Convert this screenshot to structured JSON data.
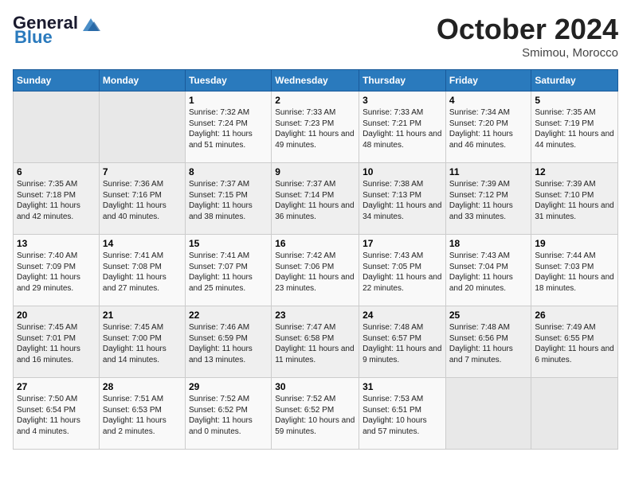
{
  "header": {
    "logo_general": "General",
    "logo_blue": "Blue",
    "month": "October 2024",
    "location": "Smimou, Morocco"
  },
  "days_of_week": [
    "Sunday",
    "Monday",
    "Tuesday",
    "Wednesday",
    "Thursday",
    "Friday",
    "Saturday"
  ],
  "weeks": [
    [
      {
        "day": "",
        "content": ""
      },
      {
        "day": "",
        "content": ""
      },
      {
        "day": "1",
        "content": "Sunrise: 7:32 AM\nSunset: 7:24 PM\nDaylight: 11 hours and 51 minutes."
      },
      {
        "day": "2",
        "content": "Sunrise: 7:33 AM\nSunset: 7:23 PM\nDaylight: 11 hours and 49 minutes."
      },
      {
        "day": "3",
        "content": "Sunrise: 7:33 AM\nSunset: 7:21 PM\nDaylight: 11 hours and 48 minutes."
      },
      {
        "day": "4",
        "content": "Sunrise: 7:34 AM\nSunset: 7:20 PM\nDaylight: 11 hours and 46 minutes."
      },
      {
        "day": "5",
        "content": "Sunrise: 7:35 AM\nSunset: 7:19 PM\nDaylight: 11 hours and 44 minutes."
      }
    ],
    [
      {
        "day": "6",
        "content": "Sunrise: 7:35 AM\nSunset: 7:18 PM\nDaylight: 11 hours and 42 minutes."
      },
      {
        "day": "7",
        "content": "Sunrise: 7:36 AM\nSunset: 7:16 PM\nDaylight: 11 hours and 40 minutes."
      },
      {
        "day": "8",
        "content": "Sunrise: 7:37 AM\nSunset: 7:15 PM\nDaylight: 11 hours and 38 minutes."
      },
      {
        "day": "9",
        "content": "Sunrise: 7:37 AM\nSunset: 7:14 PM\nDaylight: 11 hours and 36 minutes."
      },
      {
        "day": "10",
        "content": "Sunrise: 7:38 AM\nSunset: 7:13 PM\nDaylight: 11 hours and 34 minutes."
      },
      {
        "day": "11",
        "content": "Sunrise: 7:39 AM\nSunset: 7:12 PM\nDaylight: 11 hours and 33 minutes."
      },
      {
        "day": "12",
        "content": "Sunrise: 7:39 AM\nSunset: 7:10 PM\nDaylight: 11 hours and 31 minutes."
      }
    ],
    [
      {
        "day": "13",
        "content": "Sunrise: 7:40 AM\nSunset: 7:09 PM\nDaylight: 11 hours and 29 minutes."
      },
      {
        "day": "14",
        "content": "Sunrise: 7:41 AM\nSunset: 7:08 PM\nDaylight: 11 hours and 27 minutes."
      },
      {
        "day": "15",
        "content": "Sunrise: 7:41 AM\nSunset: 7:07 PM\nDaylight: 11 hours and 25 minutes."
      },
      {
        "day": "16",
        "content": "Sunrise: 7:42 AM\nSunset: 7:06 PM\nDaylight: 11 hours and 23 minutes."
      },
      {
        "day": "17",
        "content": "Sunrise: 7:43 AM\nSunset: 7:05 PM\nDaylight: 11 hours and 22 minutes."
      },
      {
        "day": "18",
        "content": "Sunrise: 7:43 AM\nSunset: 7:04 PM\nDaylight: 11 hours and 20 minutes."
      },
      {
        "day": "19",
        "content": "Sunrise: 7:44 AM\nSunset: 7:03 PM\nDaylight: 11 hours and 18 minutes."
      }
    ],
    [
      {
        "day": "20",
        "content": "Sunrise: 7:45 AM\nSunset: 7:01 PM\nDaylight: 11 hours and 16 minutes."
      },
      {
        "day": "21",
        "content": "Sunrise: 7:45 AM\nSunset: 7:00 PM\nDaylight: 11 hours and 14 minutes."
      },
      {
        "day": "22",
        "content": "Sunrise: 7:46 AM\nSunset: 6:59 PM\nDaylight: 11 hours and 13 minutes."
      },
      {
        "day": "23",
        "content": "Sunrise: 7:47 AM\nSunset: 6:58 PM\nDaylight: 11 hours and 11 minutes."
      },
      {
        "day": "24",
        "content": "Sunrise: 7:48 AM\nSunset: 6:57 PM\nDaylight: 11 hours and 9 minutes."
      },
      {
        "day": "25",
        "content": "Sunrise: 7:48 AM\nSunset: 6:56 PM\nDaylight: 11 hours and 7 minutes."
      },
      {
        "day": "26",
        "content": "Sunrise: 7:49 AM\nSunset: 6:55 PM\nDaylight: 11 hours and 6 minutes."
      }
    ],
    [
      {
        "day": "27",
        "content": "Sunrise: 7:50 AM\nSunset: 6:54 PM\nDaylight: 11 hours and 4 minutes."
      },
      {
        "day": "28",
        "content": "Sunrise: 7:51 AM\nSunset: 6:53 PM\nDaylight: 11 hours and 2 minutes."
      },
      {
        "day": "29",
        "content": "Sunrise: 7:52 AM\nSunset: 6:52 PM\nDaylight: 11 hours and 0 minutes."
      },
      {
        "day": "30",
        "content": "Sunrise: 7:52 AM\nSunset: 6:52 PM\nDaylight: 10 hours and 59 minutes."
      },
      {
        "day": "31",
        "content": "Sunrise: 7:53 AM\nSunset: 6:51 PM\nDaylight: 10 hours and 57 minutes."
      },
      {
        "day": "",
        "content": ""
      },
      {
        "day": "",
        "content": ""
      }
    ]
  ]
}
